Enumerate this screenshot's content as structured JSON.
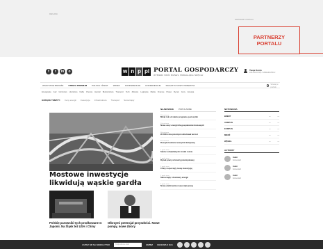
{
  "ad": {
    "label_left": "REKLAMA",
    "label_right": "PARTNERZY PORTALU",
    "partners_line1": "PARTNERZY",
    "partners_line2": "PORTALU"
  },
  "header": {
    "logo_mark": [
      "w",
      "n",
      "p",
      "pl"
    ],
    "title": "PORTAL GOSPODARCZY",
    "subtitle": "WYBIERZ SWÓJ BIZNES, PRZEGLĄDAJ WIĘCEJ",
    "social_icons": [
      "facebook-icon",
      "twitter-icon",
      "linkedin-icon",
      "instagram-icon"
    ],
    "user_name": "Twoje Konto",
    "user_sub": "ZALOGUJ SIĘ / ZAREJESTRUJ"
  },
  "nav_main": {
    "items": [
      "WSZYSTKIE BRANŻE",
      "STREFA PREMIUM",
      "POLSKA I ŚWIAT",
      "WIDEO",
      "KONFERENCJE",
      "KONFERENCJE",
      "MAGAZYN NOWY PRZEMYSŁ"
    ],
    "active_index": 1,
    "search_placeholder": "Szukaj w portalu"
  },
  "nav_sub": {
    "items": [
      "Energetyka",
      "Gaz",
      "Górnictwo",
      "Hutnictwo",
      "Nafta",
      "Chemia",
      "Handel",
      "Budownictwo",
      "Transport",
      "Tech",
      "Zdrowie",
      "Logistyka",
      "Media",
      "Finanse",
      "Prawo",
      "Rynek",
      "Ceny",
      "Energia"
    ]
  },
  "topics": {
    "label": "GORĄCE TEMATY:",
    "items": [
      "Ceny energii",
      "Inwestycje",
      "Infrastruktura",
      "Transport",
      "Samorządy"
    ]
  },
  "hero": {
    "title": "Mostowe inwestycje likwidują wąskie gardła"
  },
  "subs": [
    {
      "title": "Polskie parowniki tych prodkowane w Japonii. Na Śląsk też USA i Chiny"
    },
    {
      "title": "Olbrzymi potencjał przyszłości. Nowe pompy, nowe zbiory"
    }
  ],
  "news": {
    "tab_active": "NAJNOWSZE",
    "tab_other": "POPULARNE",
    "items": [
      {
        "time": "12 min temu",
        "text": "Minął rok od startu programu, jest wynik"
      },
      {
        "time": "24 min temu",
        "text": "Nowe ceny energii dla gospodarstw domowych"
      },
      {
        "time": "36 min temu",
        "text": "W 2023 roku przemysł odnotował wzrost"
      },
      {
        "time": "52 min temu",
        "text": "Ruszyła budowa nowej linii kolejowej"
      },
      {
        "time": "1 godz. temu",
        "text": "Sektor odnawialnych źródeł rośnie"
      },
      {
        "time": "1 godz. temu",
        "text": "Rynek pracy w branży przemysłowej"
      },
      {
        "time": "2 godz. temu",
        "text": "Chiny rozpoczęły nową inwestycję"
      },
      {
        "time": "2 godz. temu",
        "text": "Samorządy i dostawcy energii"
      },
      {
        "time": "3 godz. temu",
        "text": "Nowa elektrownia rozpoczęła pracę"
      }
    ]
  },
  "notowania": {
    "title": "NOTOWANIA",
    "rows": [
      {
        "name": "BRENT",
        "value": "—",
        "change": "—"
      },
      {
        "name": "USD/PLN",
        "value": "—",
        "change": "—"
      },
      {
        "name": "EUR/PLN",
        "value": "—",
        "change": "—"
      },
      {
        "name": "MIEDŹ",
        "value": "—",
        "change": "—"
      },
      {
        "name": "WĘGIEL",
        "value": "—",
        "change": "—"
      }
    ]
  },
  "authors": {
    "title": "AUTORZY",
    "items": [
      {
        "name": "Autor",
        "title": "Komentarz"
      },
      {
        "name": "Autor",
        "title": "Komentarz"
      },
      {
        "name": "Autor",
        "title": "Komentarz"
      }
    ]
  },
  "footer": {
    "newsletter_label": "ZAPISZ SIĘ NA NEWSLETTER",
    "email_placeholder": "Twój adres e-mail",
    "submit": "ZAPISZ",
    "follow_label": "OBSERWUJ NAS",
    "social_icons": [
      "facebook-icon",
      "twitter-icon",
      "linkedin-icon",
      "youtube-icon",
      "instagram-icon"
    ]
  }
}
